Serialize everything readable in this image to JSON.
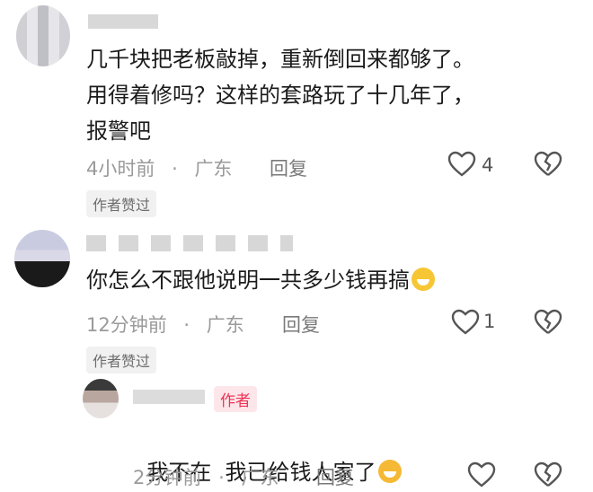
{
  "comments": [
    {
      "text_lines": [
        "几千块把老板敲掉，重新倒回来都够了。",
        "用得着修吗？这样的套路玩了十几年了，",
        "报警吧"
      ],
      "time": "4小时前",
      "location": "广东",
      "reply_label": "回复",
      "like_count": "4",
      "tag": "作者赞过",
      "dot": "·"
    },
    {
      "text_lines": [
        "你怎么不跟他说明一共多少钱再搞"
      ],
      "time": "12分钟前",
      "location": "广东",
      "reply_label": "回复",
      "like_count": "1",
      "tag": "作者赞过",
      "dot": "·",
      "emoji": "grinning-sweat"
    },
    {
      "author_badge": "作者",
      "text_lines": [
        "我不在  我已给钱人家了"
      ],
      "time": "2分钟前",
      "location": "广东",
      "reply_label": "回复",
      "like_count": "",
      "dot": "·",
      "emoji": "rolling-laughing"
    }
  ],
  "colors": {
    "author_badge": "#ee3355",
    "meta_text": "#9a9a9a"
  },
  "icons": [
    "heart-outline-icon",
    "broken-heart-icon"
  ]
}
